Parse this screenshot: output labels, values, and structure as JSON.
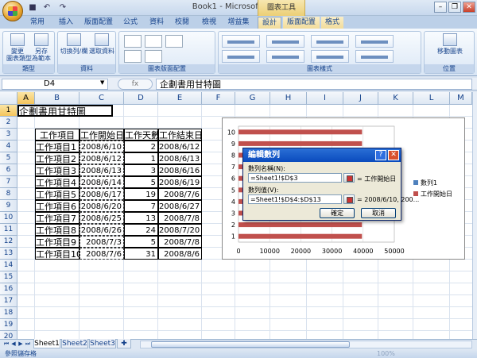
{
  "app": {
    "title": "Book1 - Microsoft Excel",
    "context_title": "圖表工具",
    "qat_undo": "↶",
    "qat_redo": "↷",
    "qat_save": "■"
  },
  "tabs": [
    {
      "label": "常用"
    },
    {
      "label": "插入"
    },
    {
      "label": "版面配置"
    },
    {
      "label": "公式"
    },
    {
      "label": "資料"
    },
    {
      "label": "校閱"
    },
    {
      "label": "檢視"
    },
    {
      "label": "增益集"
    },
    {
      "label": "設計"
    },
    {
      "label": "版面配置"
    },
    {
      "label": "格式"
    }
  ],
  "ribbon": {
    "change_type_label": "變更\n圖表類型",
    "save_template_label": "另存\n為範本",
    "group_type": "類型",
    "switch_label": "切換列/欄",
    "select_data_label": "選取資料",
    "group_data": "資料",
    "group_layout": "圖表版面配置",
    "group_styles": "圖表樣式",
    "move_chart_label": "移動圖表",
    "group_location": "位置"
  },
  "formula_bar": {
    "name_box": "D4",
    "fx_label": "fx",
    "content": "企劃書用甘特圖"
  },
  "columns": [
    "A",
    "B",
    "C",
    "D",
    "E",
    "F",
    "G",
    "H",
    "I",
    "J",
    "K",
    "L",
    "M"
  ],
  "rows": [
    "1",
    "2",
    "3",
    "4",
    "5",
    "6",
    "7",
    "8",
    "9",
    "10",
    "11",
    "12",
    "13",
    "14",
    "15",
    "16",
    "17",
    "18",
    "19",
    "20"
  ],
  "sheet": {
    "title": "企劃書用甘特圖",
    "headers": [
      "工作項目",
      "工作開始日",
      "工作天數",
      "工作結束日"
    ],
    "data": [
      [
        "工作項目1",
        "2008/6/10",
        "2",
        "2008/6/12"
      ],
      [
        "工作項目2",
        "2008/6/12",
        "1",
        "2008/6/13"
      ],
      [
        "工作項目3",
        "2008/6/13",
        "3",
        "2008/6/16"
      ],
      [
        "工作項目4",
        "2008/6/14",
        "5",
        "2008/6/19"
      ],
      [
        "工作項目5",
        "2008/6/17",
        "19",
        "2008/7/6"
      ],
      [
        "工作項目6",
        "2008/6/20",
        "7",
        "2008/6/27"
      ],
      [
        "工作項目7",
        "2008/6/25",
        "13",
        "2008/7/8"
      ],
      [
        "工作項目8",
        "2008/6/26",
        "24",
        "2008/7/20"
      ],
      [
        "工作項目9",
        "2008/7/3",
        "5",
        "2008/7/8"
      ],
      [
        "工作項目10",
        "2008/7/6",
        "31",
        "2008/8/6"
      ]
    ]
  },
  "chart_data": {
    "type": "bar",
    "orientation": "horizontal",
    "categories": [
      "1",
      "2",
      "3",
      "4",
      "5",
      "6",
      "7",
      "8",
      "9",
      "10"
    ],
    "series": [
      {
        "name": "數列1",
        "color": "#4f81bd",
        "values": []
      },
      {
        "name": "工作開始日",
        "color": "#c0504d",
        "values": [
          39609,
          39611,
          39612,
          39613,
          39616,
          39619,
          39624,
          39625,
          39632,
          39635
        ]
      }
    ],
    "x_ticks": [
      "0",
      "10000",
      "20000",
      "30000",
      "40000",
      "50000"
    ],
    "xlim": [
      0,
      50000
    ],
    "legend": "right"
  },
  "dialog": {
    "title": "編輯數列",
    "help": "?",
    "close": "✕",
    "name_label": "數列名稱(N):",
    "name_value": "=Sheet1!$D$3",
    "name_preview": "= 工作開始日",
    "values_label": "數列值(V):",
    "values_value": "=Sheet1!$D$4:$D$13",
    "values_preview": "= 2008/6/10, 200...",
    "ok": "確定",
    "cancel": "取消"
  },
  "sheet_tabs": [
    "Sheet1",
    "Sheet2",
    "Sheet3"
  ],
  "status": {
    "text": "參照儲存格",
    "zoom": "100%"
  }
}
